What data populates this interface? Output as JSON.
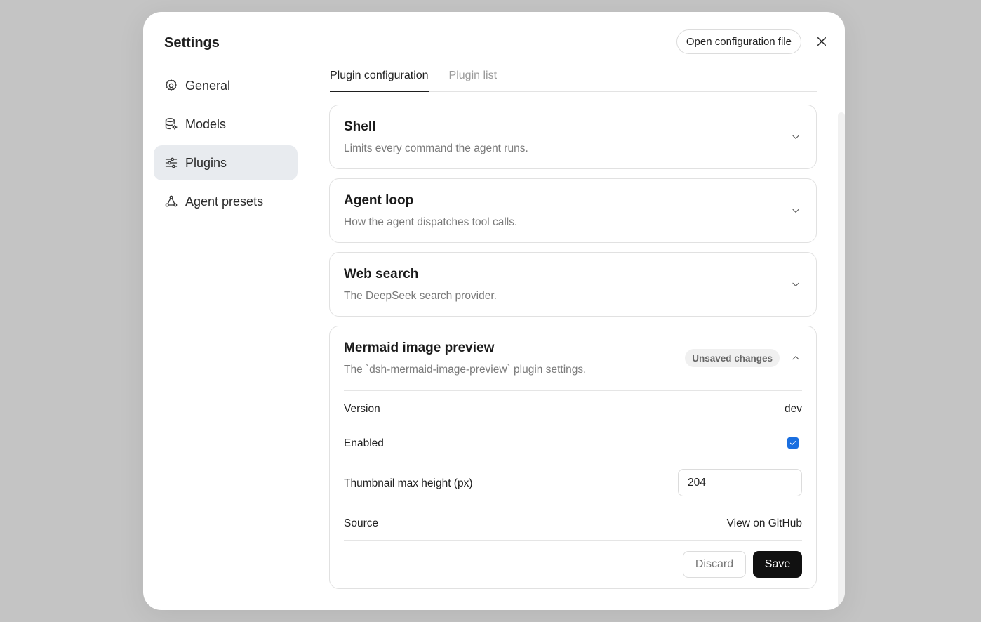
{
  "settings_title": "Settings",
  "sidebar": {
    "items": [
      {
        "label": "General",
        "icon": "gear-icon",
        "active": false
      },
      {
        "label": "Models",
        "icon": "database-icon",
        "active": false
      },
      {
        "label": "Plugins",
        "icon": "sliders-icon",
        "active": true
      },
      {
        "label": "Agent presets",
        "icon": "agent-icon",
        "active": false
      }
    ]
  },
  "header": {
    "open_config_label": "Open configuration file",
    "close_icon": "close-icon"
  },
  "tabs": [
    {
      "label": "Plugin configuration",
      "active": true
    },
    {
      "label": "Plugin list",
      "active": false
    }
  ],
  "plugins": [
    {
      "title": "Shell",
      "description": "Limits every command the agent runs.",
      "expanded": false
    },
    {
      "title": "Agent loop",
      "description": "How the agent dispatches tool calls.",
      "expanded": false
    },
    {
      "title": "Web search",
      "description": "The DeepSeek search provider.",
      "expanded": false
    },
    {
      "title": "Mermaid image preview",
      "description": "The `dsh-mermaid-image-preview` plugin settings.",
      "expanded": true,
      "badge": "Unsaved changes",
      "fields": {
        "version_label": "Version",
        "version_value": "dev",
        "enabled_label": "Enabled",
        "enabled_value": true,
        "thumbnail_label": "Thumbnail max height (px)",
        "thumbnail_value": "204",
        "source_label": "Source",
        "source_link": "View on GitHub"
      },
      "actions": {
        "discard_label": "Discard",
        "save_label": "Save"
      }
    }
  ],
  "colors": {
    "accent": "#1a6fe0",
    "primary_button": "#111111",
    "backdrop": "#c4c4c4"
  }
}
